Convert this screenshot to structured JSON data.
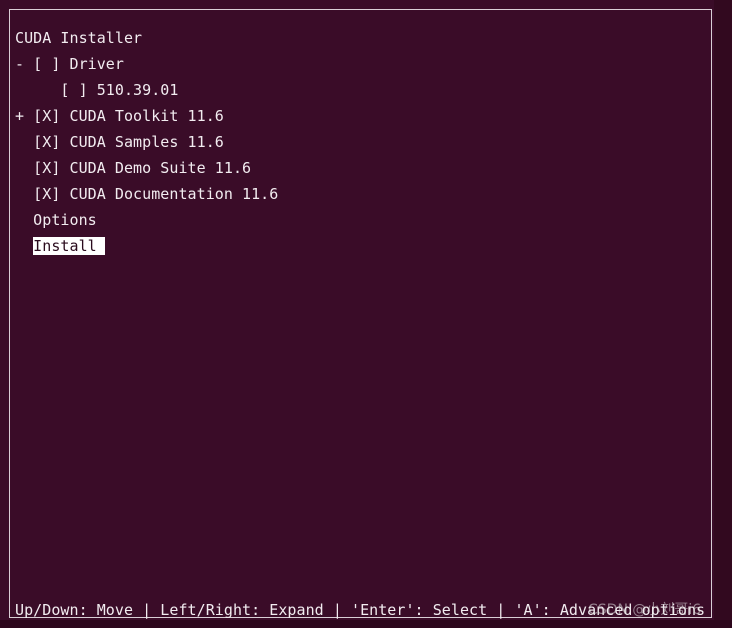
{
  "installer": {
    "title": "CUDA Installer",
    "items": [
      "- [ ] Driver",
      "     [ ] 510.39.01",
      "+ [X] CUDA Toolkit 11.6",
      "  [X] CUDA Samples 11.6",
      "  [X] CUDA Demo Suite 11.6",
      "  [X] CUDA Documentation 11.6",
      "  Options"
    ],
    "install_prefix": "  ",
    "install_label": "Install",
    "status_bar": "Up/Down: Move | Left/Right: Expand | 'Enter': Select | 'A': Advanced options"
  },
  "watermark": "CSDN @小刘哥i6",
  "colors": {
    "background": "#3a0c28",
    "text": "#f2ecf0",
    "selection_bg": "#ffffff",
    "selection_text": "#2a0b1d"
  }
}
